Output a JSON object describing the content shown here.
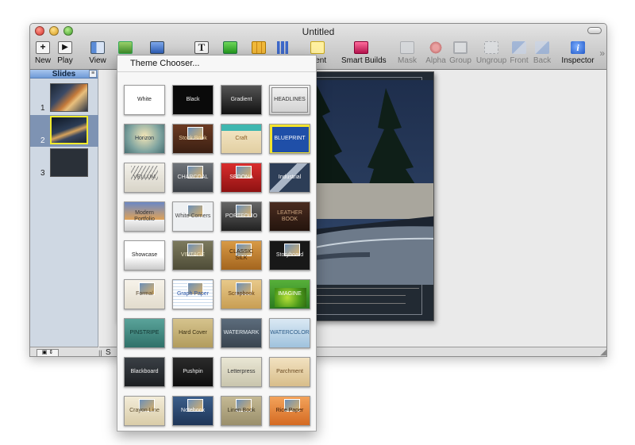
{
  "window": {
    "title": "Untitled"
  },
  "toolbar": {
    "new_label": "New",
    "play_label": "Play",
    "view_label": "View",
    "comment_label": "ment",
    "smart_builds_label": "Smart Builds",
    "mask_label": "Mask",
    "alpha_label": "Alpha",
    "group_label": "Group",
    "ungroup_label": "Ungroup",
    "front_label": "Front",
    "back_label": "Back",
    "inspector_label": "Inspector",
    "overflow_glyph": "»"
  },
  "sidebar": {
    "title": "Slides",
    "slides": [
      {
        "number": "1",
        "selected": false
      },
      {
        "number": "2",
        "selected": true
      },
      {
        "number": "3",
        "selected": false
      }
    ]
  },
  "canvas": {
    "footer_letter": "S"
  },
  "theme_chooser": {
    "header": "Theme Chooser...",
    "themes": [
      {
        "label": "White"
      },
      {
        "label": "Black"
      },
      {
        "label": "Gradient"
      },
      {
        "label": "HEADLINES"
      },
      {
        "label": "Horizon"
      },
      {
        "label": "Stock Book"
      },
      {
        "label": "Craft"
      },
      {
        "label": "BLUEPRINT"
      },
      {
        "label": "VELLUM"
      },
      {
        "label": "CHARCOAL"
      },
      {
        "label": "SEDONA"
      },
      {
        "label": "Industrial"
      },
      {
        "label": "Modern Portfolio"
      },
      {
        "label": "White Corners"
      },
      {
        "label": "PORTFOLIO"
      },
      {
        "label": "LEATHER BOOK"
      },
      {
        "label": "Showcase"
      },
      {
        "label": "VINTAGE"
      },
      {
        "label": "CLASSIC SILK"
      },
      {
        "label": "Storyboard"
      },
      {
        "label": "Formal"
      },
      {
        "label": "Graph Paper"
      },
      {
        "label": "Scrapbook"
      },
      {
        "label": "IMAGINE"
      },
      {
        "label": "PINSTRIPE"
      },
      {
        "label": "Hard Cover"
      },
      {
        "label": "WATERMARK"
      },
      {
        "label": "WATERCOLOR"
      },
      {
        "label": "Blackboard"
      },
      {
        "label": "Pushpin"
      },
      {
        "label": "Letterpress"
      },
      {
        "label": "Parchment"
      },
      {
        "label": "Crayon Line"
      },
      {
        "label": "Notebook"
      },
      {
        "label": "Linen Book"
      },
      {
        "label": "Rice Paper"
      }
    ]
  },
  "colors": {
    "selection_border": "#f2ea2c",
    "sidebar_header": "#6f9bd7",
    "slide_background": "#222a33"
  }
}
